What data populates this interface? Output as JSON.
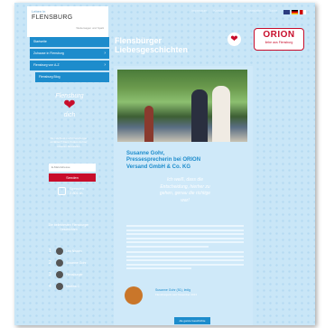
{
  "header": {
    "logo_small": "Leben in",
    "logo_main": "FLENSBURG",
    "logo_sub": "Weitersagen und Spaß",
    "top_nav": [
      "Impressum",
      "Kontakt",
      "Partner",
      "Newsletter",
      "Suche"
    ],
    "languages": [
      "en",
      "de",
      "other"
    ],
    "page_title_line1": "Flensbürger",
    "page_title_line2": "Liebesgeschichten"
  },
  "sidebar": {
    "nav_items": [
      {
        "label": "Startseite",
        "chevron": ""
      },
      {
        "label": "Zuhause in Flensburg",
        "chevron": "›"
      },
      {
        "label": "Flensburg von A-Z",
        "chevron": "›"
      }
    ],
    "sub_item": "Flensburg Blog",
    "logo_word": "Flensburg",
    "logo_heart": "❤",
    "logo_word2": "dich",
    "newsletter_text": "Du möchtest noch Flensburger erzählen? Dann findest du hier unseren Newsletter",
    "newsletter_placeholder": "E-Mail-Adresse",
    "subscribe_label": "Senden",
    "donation_label": "Spenden",
    "donation_amount": "2.801 m.",
    "rank_heading": "Die beliebtesten Flensburger Geschichten",
    "rank": [
      {
        "num": "1",
        "name": "Lea Nissen"
      },
      {
        "num": "2",
        "name": "Susanne Gohr"
      },
      {
        "num": "3",
        "name": "Flensburger"
      },
      {
        "num": "4",
        "name": "Martina C."
      }
    ]
  },
  "orion": {
    "heart": "❤",
    "brand": "ORION",
    "tagline": "liebe aus Flensburg"
  },
  "article": {
    "name_line1": "Susanne Gohr,",
    "name_line2": "Pressesprecherin bei ORION",
    "name_line3": "Versand GmbH & Co. KG",
    "quote_line1": "Ich weiß, dass die",
    "quote_line2": "Entscheidung, hierher zu",
    "quote_line3": "gehen, genau die richtige",
    "quote_line4": "war!",
    "author_name": "Susanne Gohr (51), ledig",
    "author_date": "Flensburgerin seit November 2013",
    "more_label": "die ganze Geschichte"
  }
}
